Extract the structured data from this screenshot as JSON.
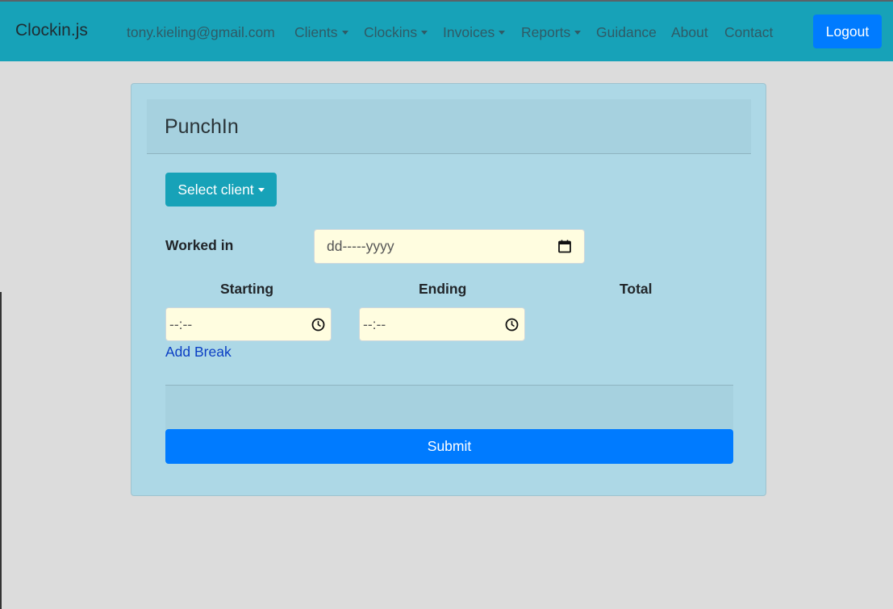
{
  "navbar": {
    "brand": "Clockin.js",
    "user_email": "tony.kieling@gmail.com",
    "items": [
      {
        "label": "Clients",
        "dropdown": true
      },
      {
        "label": "Clockins",
        "dropdown": true
      },
      {
        "label": "Invoices",
        "dropdown": true
      },
      {
        "label": "Reports",
        "dropdown": true
      },
      {
        "label": "Guidance",
        "dropdown": false
      },
      {
        "label": "About",
        "dropdown": false
      },
      {
        "label": "Contact",
        "dropdown": false
      }
    ],
    "logout_label": "Logout"
  },
  "form": {
    "title": "PunchIn",
    "select_client_label": "Select client",
    "worked_in_label": "Worked in",
    "date_placeholder": "dd-----yyyy",
    "columns": {
      "starting": "Starting",
      "ending": "Ending",
      "total": "Total"
    },
    "start_time_value": "--:--",
    "end_time_value": "--:--",
    "add_break_label": "Add Break",
    "submit_label": "Submit"
  },
  "colors": {
    "navbar_bg": "#17a2b8",
    "card_bg": "#add8e6",
    "input_bg": "#fffde0",
    "primary": "#007bff",
    "link": "#0b3fc4"
  },
  "icons": {
    "date_field": "calendar-icon",
    "time_fields": "clock-icon"
  }
}
